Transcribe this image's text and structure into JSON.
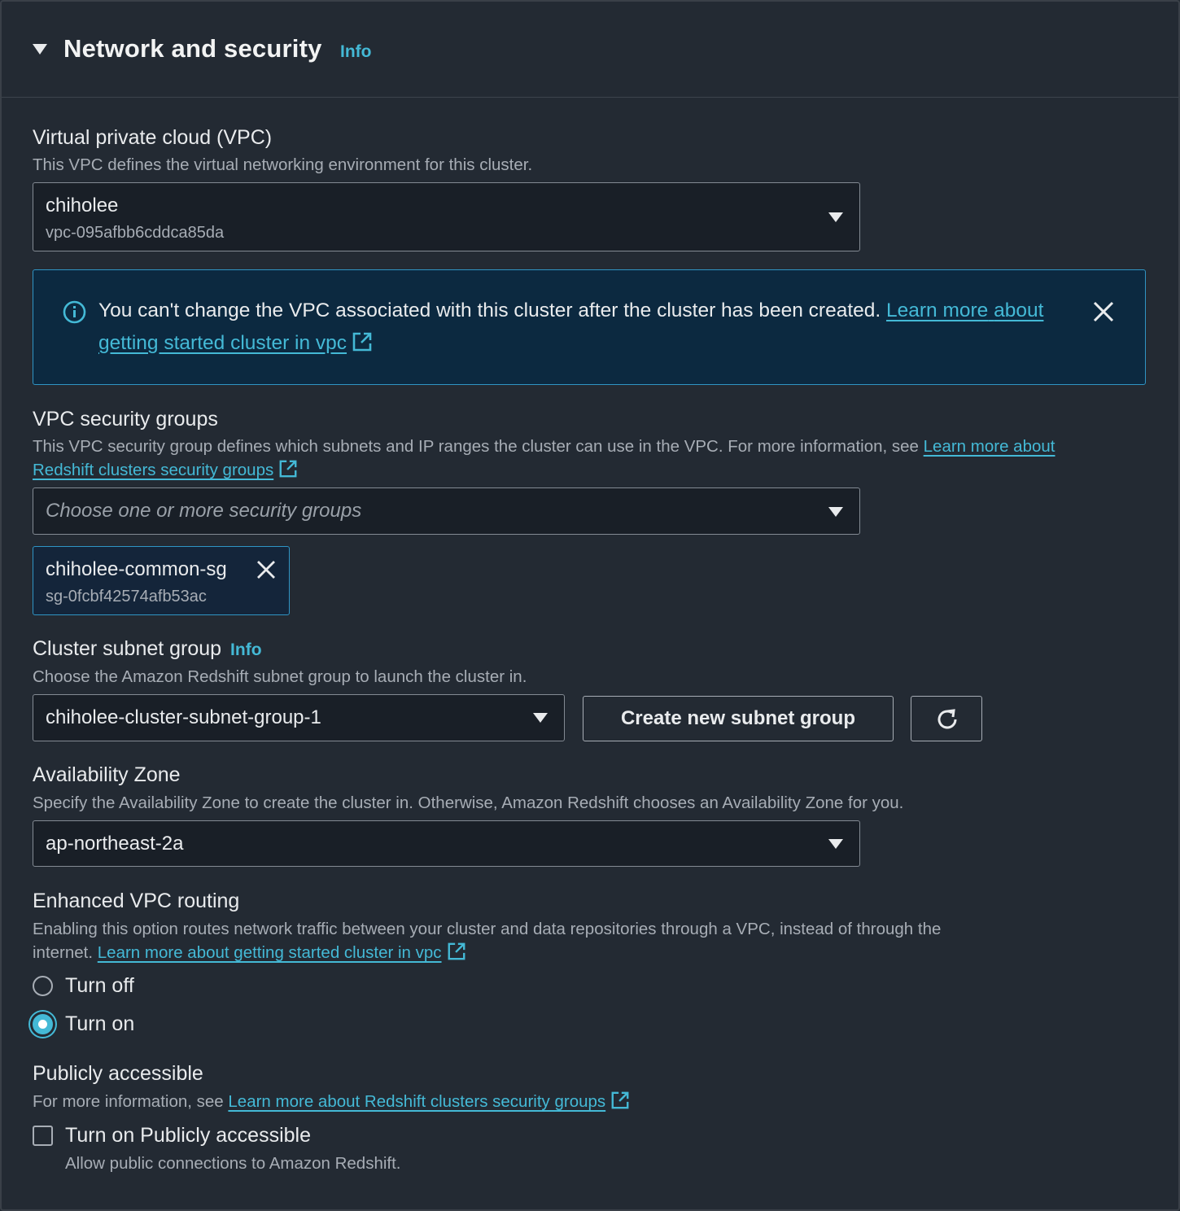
{
  "section": {
    "title": "Network and security",
    "info_label": "Info"
  },
  "vpc": {
    "label": "Virtual private cloud (VPC)",
    "description": "This VPC defines the virtual networking environment for this cluster.",
    "selected_name": "chiholee",
    "selected_id": "vpc-095afbb6cddca85da"
  },
  "alert": {
    "message": "You can't change the VPC associated with this cluster after the cluster has been created.",
    "link_part1": "Learn more",
    "link_part2": "about getting started cluster in vpc"
  },
  "security_groups": {
    "label": "VPC security groups",
    "description": "This VPC security group defines which subnets and IP ranges the cluster can use in the VPC. For more information, see",
    "link_part1": "Learn more about",
    "link_part2": "Redshift clusters security groups",
    "placeholder": "Choose one or more security groups",
    "token": {
      "name": "chiholee-common-sg",
      "id": "sg-0fcbf42574afb53ac"
    }
  },
  "subnet_group": {
    "label": "Cluster subnet group",
    "info_label": "Info",
    "description": "Choose the Amazon Redshift subnet group to launch the cluster in.",
    "selected": "chiholee-cluster-subnet-group-1",
    "create_button": "Create new subnet group"
  },
  "availability_zone": {
    "label": "Availability Zone",
    "description": "Specify the Availability Zone to create the cluster in. Otherwise, Amazon Redshift chooses an Availability Zone for you.",
    "selected": "ap-northeast-2a"
  },
  "enhanced_routing": {
    "label": "Enhanced VPC routing",
    "description_line1": "Enabling this option routes network traffic between your cluster and data repositories through a VPC, instead of through the",
    "description_line2": "internet.",
    "link": "Learn more about getting started cluster in vpc",
    "options": [
      {
        "label": "Turn off",
        "checked": false
      },
      {
        "label": "Turn on",
        "checked": true
      }
    ]
  },
  "public_access": {
    "label": "Publicly accessible",
    "description": "For more information, see",
    "link": "Learn more about Redshift clusters security groups",
    "checkbox_label": "Turn on Publicly accessible",
    "checkbox_description": "Allow public connections to Amazon Redshift.",
    "checked": false
  },
  "colors": {
    "background": "#232a33",
    "accent": "#44b9d6",
    "alert_background": "#0c2940",
    "input_background": "#191f27"
  },
  "icons": [
    "caret-down-icon",
    "info-circle-icon",
    "close-icon",
    "external-link-icon",
    "refresh-icon",
    "dropdown-caret-icon"
  ]
}
